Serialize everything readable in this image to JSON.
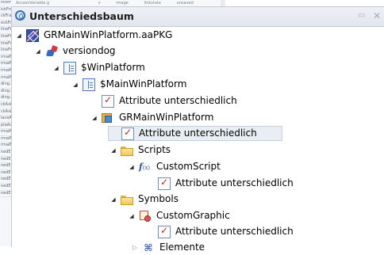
{
  "background": {
    "rows": [
      "ncomponent.g",
      "ickFrami",
      "ckFrami",
      "eckFrami",
      "lineFra",
      "lineFra",
      "lineFrai",
      "lineFra",
      "rmalFr",
      "rmalFr",
      "rmalFr",
      "rmalFr",
      "ding.g",
      "ding.g",
      "ding.g",
      "ckAxis",
      "ckAxis",
      "laceAd",
      "plaAd",
      "rmalFr",
      "rmalFr",
      "rmalFr",
      "nedEn",
      "nedEn",
      "nedEn",
      "nedEn",
      "nedEn",
      "nedEn",
      "nedEn"
    ],
    "top": [
      "AccessVariable.g",
      "v",
      "image",
      "linkstate",
      "unsaved"
    ]
  },
  "panel": {
    "title": "Unterschiedsbaum",
    "icons": {
      "title": "info-icon",
      "float": "float-window-icon",
      "close": "close-icon"
    },
    "float_glyph": "▭",
    "close_glyph": "✕"
  },
  "tree": {
    "root": {
      "label": "GRMainWinPlatform.aaPKG",
      "icon": "package-icon"
    },
    "versiondog": {
      "label": "versiondog",
      "icon": "versiondog-icon"
    },
    "winplatform": {
      "label": "$WinPlatform",
      "icon": "platform-icon"
    },
    "mainwinplatform": {
      "label": "$MainWinPlatform",
      "icon": "platform-icon"
    },
    "attr1": {
      "label": "Attribute unterschiedlich",
      "icon": "attribute-diff-icon"
    },
    "grmainwinplatform": {
      "label": "GRMainWinPlatform",
      "icon": "instance-icon"
    },
    "attr2": {
      "label": "Attribute unterschiedlich",
      "icon": "attribute-diff-icon",
      "selected": true
    },
    "scripts": {
      "label": "Scripts",
      "icon": "folder-icon"
    },
    "customscript": {
      "label": "CustomScript",
      "icon": "script-icon"
    },
    "attr3": {
      "label": "Attribute unterschiedlich",
      "icon": "attribute-diff-icon"
    },
    "symbols": {
      "label": "Symbols",
      "icon": "folder-icon"
    },
    "customgraphic": {
      "label": "CustomGraphic",
      "icon": "graphic-icon"
    },
    "attr4": {
      "label": "Attribute unterschiedlich",
      "icon": "attribute-diff-icon"
    },
    "elemente": {
      "label": "Elemente",
      "icon": "elements-icon"
    }
  },
  "glyphs": {
    "expanded": "◢",
    "collapsed": "▷",
    "script_fx": "f",
    "script_sub": "(x)",
    "elemente": "⌘"
  },
  "colors": {
    "selection_bg": "#e9eef5",
    "titlebar": "#e1e6ec",
    "check": "#d02020"
  }
}
